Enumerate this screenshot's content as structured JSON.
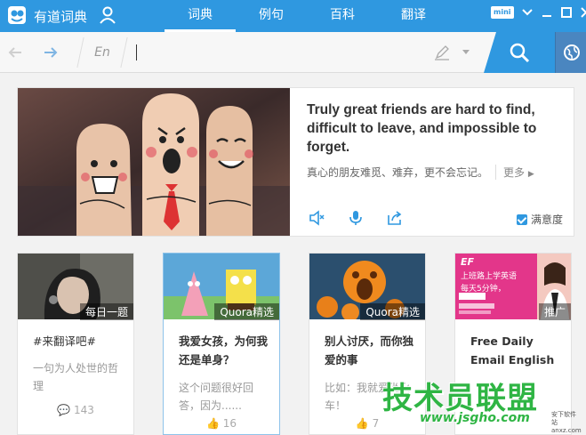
{
  "titlebar": {
    "app_name": "有道词典",
    "tabs": [
      {
        "label": "词典",
        "active": true
      },
      {
        "label": "例句",
        "active": false
      },
      {
        "label": "百科",
        "active": false
      },
      {
        "label": "翻译",
        "active": false
      }
    ],
    "mini_label": "mini"
  },
  "search": {
    "lang": "En",
    "value": "",
    "placeholder": ""
  },
  "daily": {
    "quote_en": "Truly great friends are hard to find, difficult to leave, and impossible to forget.",
    "quote_cn": "真心的朋友难觅、难弃，更不会忘记。",
    "more_label": "更多",
    "satisfaction_label": "满意度",
    "satisfaction_checked": true
  },
  "cards": [
    {
      "tag": "每日一题",
      "title": "#来翻译吧#",
      "desc": "一句为人处世的哲理",
      "count": "143"
    },
    {
      "tag": "Quora精选",
      "title": "我爱女孩，为何我还是单身？",
      "desc": "这个问题很好回答，因为......",
      "count": "16"
    },
    {
      "tag": "Quora精选",
      "title": "别人讨厌，而你独爱的事",
      "desc": "比如：我就爱坐火车！",
      "count": "7"
    },
    {
      "tag": "推广",
      "title": "Free Daily Email English",
      "desc": "",
      "count": "",
      "ad_text": "上班路上学英语",
      "ad_sub": "每天5分钟，",
      "ad_brand": "EF"
    }
  ],
  "watermark": {
    "text": "技术员联盟",
    "url": "www.jsgho.com",
    "small": "安下软件站 anxz.com"
  },
  "colors": {
    "accent": "#2f98e0",
    "watermark": "#2fb544"
  }
}
